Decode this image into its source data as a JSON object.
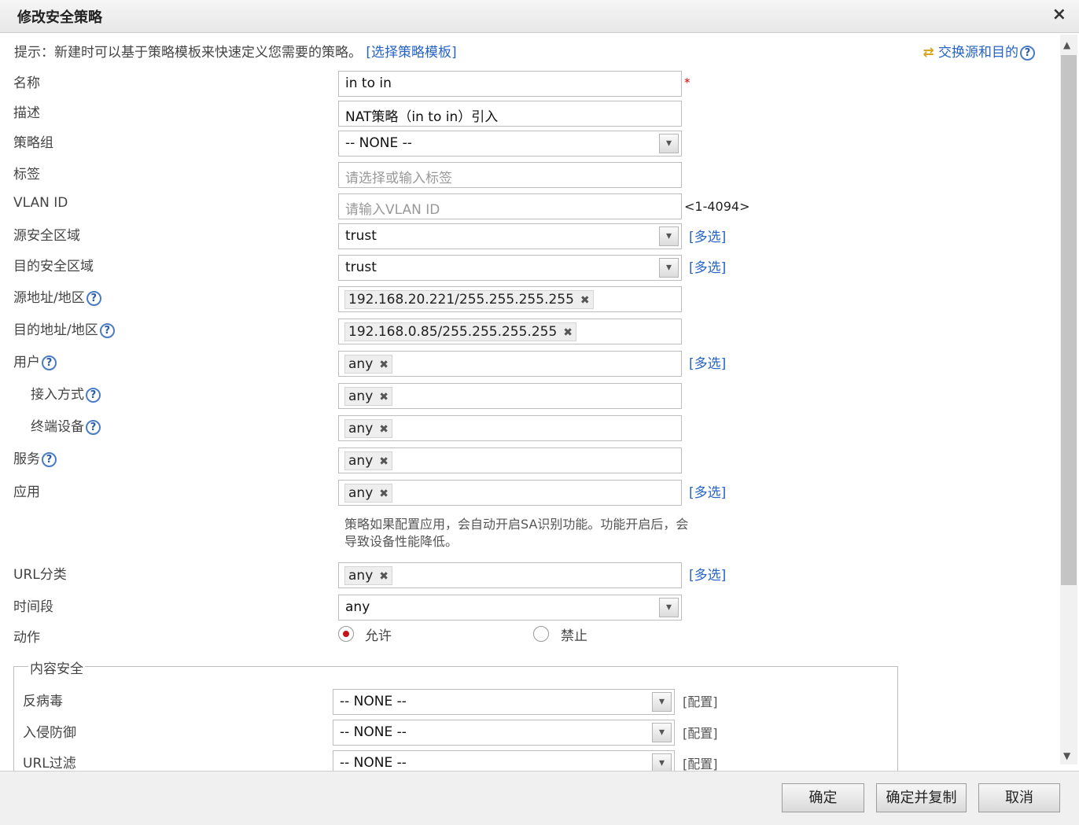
{
  "dialog": {
    "title": "修改安全策略",
    "close": "×"
  },
  "hint": {
    "text": "提示：新建时可以基于策略模板来快速定义您需要的策略。",
    "link": "[选择策略模板]"
  },
  "swap": {
    "icon": "⇄",
    "label": "交换源和目的"
  },
  "help_glyph": "?",
  "required_mark": "*",
  "dropdown_arrow": "▾",
  "remove_glyph": "✖",
  "form": {
    "name": {
      "label": "名称",
      "value": "in to in"
    },
    "desc": {
      "label": "描述",
      "value": "NAT策略（in to in）引入"
    },
    "group": {
      "label": "策略组",
      "value": "-- NONE --"
    },
    "tags": {
      "label": "标签",
      "placeholder": "请选择或输入标签"
    },
    "vlan": {
      "label": "VLAN ID",
      "placeholder": "请输入VLAN ID",
      "range": "<1-4094>"
    },
    "src_zone": {
      "label": "源安全区域",
      "value": "trust",
      "multi": "[多选]"
    },
    "dst_zone": {
      "label": "目的安全区域",
      "value": "trust",
      "multi": "[多选]"
    },
    "src_addr": {
      "label": "源地址/地区",
      "tag": "192.168.20.221/255.255.255.255"
    },
    "dst_addr": {
      "label": "目的地址/地区",
      "tag": "192.168.0.85/255.255.255.255"
    },
    "user": {
      "label": "用户",
      "tag": "any",
      "multi": "[多选]"
    },
    "access": {
      "label": "接入方式",
      "tag": "any"
    },
    "terminal": {
      "label": "终端设备",
      "tag": "any"
    },
    "service": {
      "label": "服务",
      "tag": "any"
    },
    "app": {
      "label": "应用",
      "tag": "any",
      "multi": "[多选]",
      "note": "策略如果配置应用，会自动开启SA识别功能。功能开启后，会导致设备性能降低。"
    },
    "url": {
      "label": "URL分类",
      "tag": "any",
      "multi": "[多选]"
    },
    "time": {
      "label": "时间段",
      "value": "any"
    },
    "action": {
      "label": "动作",
      "allow": "允许",
      "deny": "禁止",
      "selected": "允许"
    }
  },
  "content_security": {
    "legend": "内容安全",
    "rows": [
      {
        "label": "反病毒",
        "value": "-- NONE --",
        "config": "[配置]"
      },
      {
        "label": "入侵防御",
        "value": "-- NONE --",
        "config": "[配置]"
      },
      {
        "label": "URL过滤",
        "value": "-- NONE --",
        "config": "[配置]"
      }
    ]
  },
  "buttons": {
    "ok": "确定",
    "ok_copy": "确定并复制",
    "cancel": "取消"
  },
  "scrollbar": {
    "up": "▲",
    "down": "▼"
  }
}
